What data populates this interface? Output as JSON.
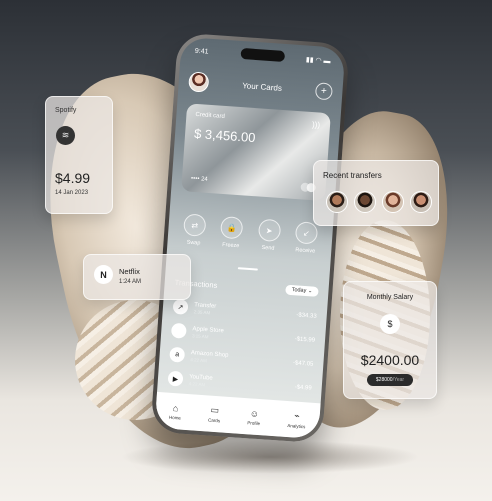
{
  "phone": {
    "status_time": "9:41",
    "status_icons": "▮▮ ◠ ▬",
    "header_title": "Your Cards",
    "add_label": "+",
    "card": {
      "label": "Credit card",
      "amount": "$ 3,456.00",
      "number": "•••• 24",
      "nfc": ")))"
    },
    "actions": [
      {
        "label": "Swap",
        "icon": "⇄"
      },
      {
        "label": "Freeze",
        "icon": "🔒"
      },
      {
        "label": "Send",
        "icon": "➤"
      },
      {
        "label": "Receive",
        "icon": "↙"
      }
    ],
    "transactions_title": "Transactions",
    "filter": "Today ⌄",
    "transactions": [
      {
        "name": "Transfer",
        "time": "2:35 AM",
        "amount": "-$34.33",
        "icon": "↗"
      },
      {
        "name": "Apple Store",
        "time": "3:15 AM",
        "amount": "-$15.99",
        "icon": ""
      },
      {
        "name": "Amazon Shop",
        "time": "4:22 AM",
        "amount": "-$47.05",
        "icon": "a"
      },
      {
        "name": "YouTube",
        "time": "4:22 AM",
        "amount": "-$4.99",
        "icon": "▶"
      }
    ],
    "nav": [
      {
        "label": "Home",
        "icon": "⌂"
      },
      {
        "label": "Cards",
        "icon": "▭"
      },
      {
        "label": "Profile",
        "icon": "☺"
      },
      {
        "label": "Analytics",
        "icon": "⌁"
      }
    ]
  },
  "spotify": {
    "name": "Spotify",
    "icon": "≋",
    "price": "$4.99",
    "date": "14 Jan 2023"
  },
  "netflix": {
    "icon": "N",
    "name": "Netflix",
    "time": "1:24 AM"
  },
  "recent": {
    "title": "Recent transfers"
  },
  "salary": {
    "title": "Monthly Salary",
    "icon": "$",
    "amount": "$2400.00",
    "target": "$28000",
    "target_suffix": "/Year"
  },
  "colors": {
    "accent": "#2b2b2b",
    "card": "#9aa0a3"
  }
}
